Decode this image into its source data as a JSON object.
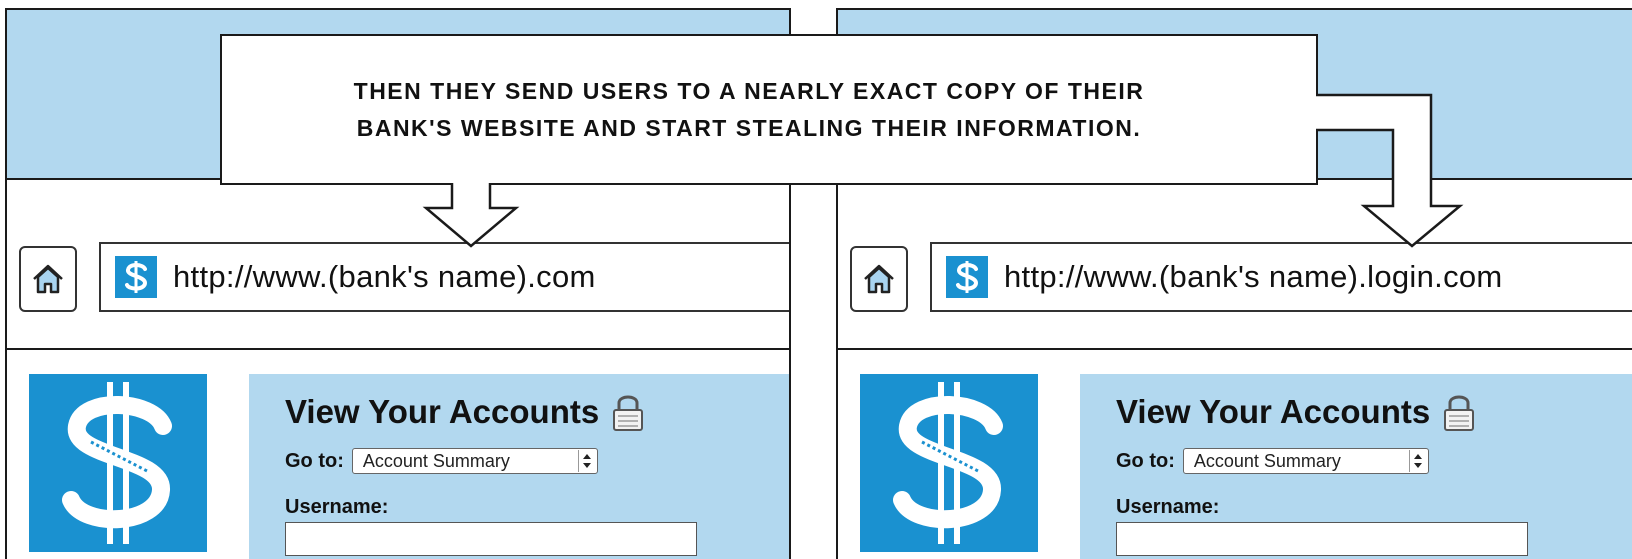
{
  "callout": {
    "line1": "THEN THEY SEND USERS TO A NEARLY EXACT COPY OF THEIR",
    "line2": "BANK'S WEBSITE AND START STEALING THEIR INFORMATION."
  },
  "left_browser": {
    "url": "http://www.(bank's name).com",
    "home_icon": "home-icon",
    "favicon": "dollar-sign",
    "login": {
      "title": "View Your Accounts",
      "goto_label": "Go to:",
      "goto_value": "Account Summary",
      "username_label": "Username:",
      "username_value": ""
    }
  },
  "right_browser": {
    "url": "http://www.(bank's name).login.com",
    "home_icon": "home-icon",
    "favicon": "dollar-sign",
    "login": {
      "title": "View Your Accounts",
      "goto_label": "Go to:",
      "goto_value": "Account Summary",
      "username_label": "Username:",
      "username_value": ""
    }
  },
  "colors": {
    "sky": "#b2d8ef",
    "brand_blue": "#1a91d0",
    "outline": "#1a1a1a"
  }
}
